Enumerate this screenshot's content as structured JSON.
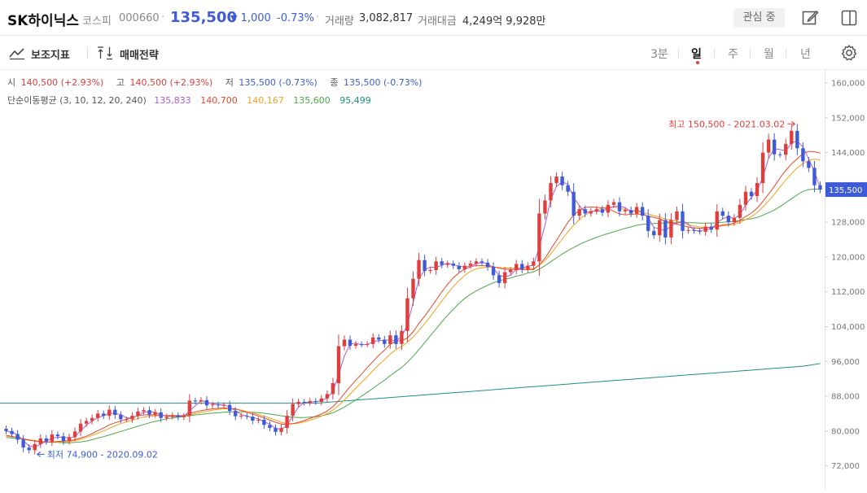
{
  "header": {
    "name": "SK하이닉스",
    "market": "코스피",
    "code": "000660",
    "price": "135,500",
    "change_arrow": "▼",
    "change": "1,000",
    "change_pct": "-0.73%",
    "volume_label": "거래량",
    "volume": "3,082,817",
    "amount_label": "거래대금",
    "amount": "4,249억 9,928만",
    "favorite_label": "관심 중"
  },
  "toolbar": {
    "indicator_label": "보조지표",
    "strategy_label": "매매전략",
    "periods": [
      "3분",
      "일",
      "주",
      "월",
      "년"
    ],
    "active_period": "일"
  },
  "legend": {
    "open_label": "시",
    "open": "140,500 (+2.93%)",
    "high_label": "고",
    "high": "140,500 (+2.93%)",
    "low_label": "저",
    "low": "135,500 (-0.73%)",
    "close_label": "종",
    "close": "135,500 (-0.73%)",
    "ma_label": "단순이동평균 (3, 10, 12, 20, 240)",
    "ma_values": [
      "135,833",
      "140,700",
      "140,167",
      "135,600",
      "95,499"
    ]
  },
  "colors": {
    "up": "#e03d3d",
    "down": "#3e5bd8",
    "ma3": "#b05bd6",
    "ma10": "#e8482a",
    "ma12": "#f2a11e",
    "ma20": "#4aa84a",
    "ma240": "#1f8f86"
  },
  "chart_data": {
    "type": "candlestick",
    "ylim": [
      66500,
      163000
    ],
    "y_ticks": [
      160000,
      152000,
      144000,
      136000,
      128000,
      120000,
      112000,
      104000,
      96000,
      88000,
      80000,
      72000
    ],
    "y_tick_labels": [
      "160,000",
      "152,000",
      "144,000",
      "135,500",
      "128,000",
      "120,000",
      "112,000",
      "104,000",
      "96,000",
      "88,000",
      "80,000",
      "72,000"
    ],
    "current_price": 135500,
    "current_price_label": "135,500",
    "max_annotation": "최고 150,500 - 2021.03.02",
    "min_annotation": "최저 74,900 - 2020.09.02",
    "close": [
      80000,
      79300,
      78000,
      76200,
      75600,
      77000,
      78300,
      77600,
      79200,
      78800,
      77700,
      78600,
      79900,
      81700,
      82300,
      83000,
      84000,
      83500,
      84900,
      83700,
      82700,
      82700,
      83500,
      84500,
      84800,
      83800,
      84300,
      83000,
      83300,
      83600,
      83200,
      83500,
      87000,
      86800,
      87100,
      85900,
      86100,
      85900,
      86000,
      84600,
      83400,
      83500,
      83300,
      82400,
      82600,
      81400,
      80700,
      79800,
      80700,
      83500,
      86200,
      86700,
      86500,
      86900,
      86700,
      87500,
      88500,
      91000,
      99500,
      101000,
      99600,
      100000,
      99900,
      100000,
      101500,
      101000,
      100000,
      102000,
      100000,
      103000,
      110500,
      115000,
      119300,
      116800,
      117000,
      119000,
      118200,
      118500,
      118000,
      117200,
      118000,
      118500,
      119000,
      118700,
      117700,
      115800,
      114000,
      116500,
      117000,
      118400,
      117200,
      118000,
      119000,
      130000,
      133000,
      137000,
      138500,
      136500,
      135000,
      129500,
      131000,
      130000,
      130500,
      131000,
      130200,
      132000,
      132600,
      130500,
      130800,
      130000,
      131500,
      129500,
      126000,
      125000,
      128500,
      124500,
      128500,
      130500,
      126000,
      126200,
      126000,
      125800,
      127000,
      126300,
      130500,
      129500,
      128000,
      129000,
      132000,
      135000,
      134000,
      137000,
      144000,
      147000,
      143600,
      143500,
      146000,
      149000,
      145000,
      142000,
      140500,
      136500,
      135500
    ],
    "ma3": [
      80000,
      79700,
      79100,
      77800,
      76600,
      76300,
      77000,
      77600,
      78400,
      78500,
      78600,
      78400,
      78700,
      80100,
      81300,
      82300,
      83100,
      83500,
      84100,
      84000,
      83800,
      83000,
      83000,
      83600,
      84300,
      84400,
      84300,
      83700,
      83500,
      83300,
      83400,
      83400,
      84600,
      85800,
      87000,
      86600,
      86300,
      86000,
      86000,
      85500,
      84700,
      83800,
      83400,
      83100,
      82800,
      82100,
      81600,
      80600,
      80400,
      81300,
      83500,
      85500,
      86500,
      86700,
      86700,
      87000,
      87600,
      89000,
      93000,
      97200,
      100000,
      100200,
      99800,
      99900,
      100500,
      100800,
      100800,
      101000,
      100700,
      101700,
      104500,
      109500,
      115000,
      117000,
      117700,
      117600,
      118100,
      118600,
      118200,
      117900,
      117700,
      117900,
      118500,
      118700,
      118500,
      117400,
      115800,
      115400,
      115800,
      117300,
      117500,
      117900,
      118100,
      122300,
      127300,
      133300,
      136200,
      137300,
      136700,
      133700,
      131800,
      130200,
      130500,
      130500,
      130600,
      131100,
      131600,
      131700,
      131300,
      130400,
      130800,
      130300,
      129000,
      126800,
      126500,
      126000,
      127200,
      127800,
      128300,
      127600,
      126100,
      126000,
      126300,
      126400,
      127900,
      128800,
      129300,
      128800,
      129700,
      132000,
      133700,
      135300,
      138300,
      142700,
      144900,
      144700,
      144400,
      146200,
      146700,
      145300,
      142500,
      139700,
      135800
    ],
    "ma10": [
      79000,
      78800,
      78500,
      78200,
      77900,
      77700,
      77500,
      77400,
      77500,
      77600,
      77700,
      77800,
      78000,
      78400,
      78800,
      79400,
      80100,
      80700,
      81400,
      81900,
      82300,
      82700,
      83100,
      83500,
      83700,
      83700,
      83700,
      83600,
      83500,
      83500,
      83500,
      83600,
      84000,
      84400,
      84700,
      84900,
      85100,
      85200,
      85300,
      85200,
      85100,
      84700,
      84300,
      83900,
      83500,
      83000,
      82500,
      82000,
      81600,
      81500,
      81700,
      82000,
      82400,
      82900,
      83400,
      83900,
      84600,
      85600,
      87000,
      88600,
      90200,
      91700,
      93100,
      94600,
      96000,
      97400,
      98600,
      99900,
      100700,
      100800,
      101400,
      102800,
      104700,
      106400,
      108200,
      110100,
      112000,
      113700,
      115200,
      116400,
      117300,
      117700,
      118100,
      118000,
      118000,
      117800,
      117400,
      117200,
      117100,
      117200,
      117100,
      117100,
      117100,
      118200,
      119700,
      121800,
      123800,
      125900,
      128000,
      129600,
      130800,
      131400,
      131500,
      131400,
      131300,
      131100,
      130500,
      129900,
      129700,
      129800,
      129900,
      129800,
      129400,
      129100,
      128800,
      128200,
      127900,
      127600,
      127200,
      126900,
      126700,
      126600,
      126700,
      126800,
      127000,
      127400,
      127500,
      127800,
      128400,
      129300,
      130100,
      131200,
      132800,
      134500,
      136200,
      138200,
      139900,
      141400,
      142600,
      143800,
      144300,
      144200,
      143900
    ],
    "ma12": [
      78800,
      78700,
      78500,
      78200,
      78000,
      77800,
      77600,
      77500,
      77500,
      77500,
      77500,
      77600,
      77800,
      78100,
      78500,
      79000,
      79500,
      80000,
      80600,
      81200,
      81700,
      82100,
      82500,
      82900,
      83200,
      83400,
      83500,
      83600,
      83600,
      83600,
      83600,
      83500,
      83700,
      84000,
      84300,
      84500,
      84800,
      85000,
      85100,
      85100,
      85000,
      84800,
      84500,
      84200,
      83800,
      83400,
      83000,
      82500,
      82000,
      81700,
      81700,
      81800,
      82100,
      82500,
      82900,
      83400,
      84000,
      84800,
      85900,
      87100,
      88500,
      89900,
      91200,
      92500,
      93900,
      95200,
      96400,
      97700,
      98700,
      99400,
      100400,
      101600,
      103100,
      104700,
      106300,
      108100,
      109900,
      111600,
      113200,
      114600,
      115800,
      116700,
      117300,
      117500,
      117700,
      117700,
      117600,
      117500,
      117400,
      117400,
      117400,
      117400,
      117300,
      118100,
      119200,
      120700,
      122400,
      124100,
      125800,
      127300,
      128600,
      129700,
      130300,
      130800,
      131200,
      131500,
      131500,
      131200,
      130900,
      130600,
      130500,
      130300,
      129900,
      129500,
      129200,
      128700,
      128500,
      128200,
      127800,
      127400,
      127100,
      126900,
      126800,
      126800,
      126900,
      127200,
      127300,
      127500,
      127900,
      128600,
      129300,
      130200,
      131500,
      132900,
      134400,
      136100,
      137700,
      139200,
      140500,
      141500,
      142200,
      142500,
      142300
    ],
    "ma20": [
      78500,
      78400,
      78300,
      78100,
      77900,
      77800,
      77600,
      77500,
      77400,
      77400,
      77300,
      77300,
      77400,
      77500,
      77700,
      78000,
      78400,
      78700,
      79100,
      79500,
      79900,
      80300,
      80700,
      81100,
      81500,
      81900,
      82200,
      82500,
      82800,
      83000,
      83200,
      83300,
      83500,
      83700,
      83800,
      84000,
      84100,
      84200,
      84300,
      84400,
      84400,
      84400,
      84400,
      84300,
      84200,
      84100,
      83900,
      83700,
      83500,
      83300,
      83200,
      83100,
      83100,
      83200,
      83300,
      83500,
      83800,
      84200,
      84800,
      85500,
      86300,
      87100,
      88000,
      88900,
      89800,
      90800,
      91700,
      92700,
      93700,
      94600,
      95800,
      97200,
      98700,
      100300,
      101900,
      103500,
      105100,
      106600,
      108000,
      109300,
      110500,
      111400,
      112200,
      112900,
      113500,
      114100,
      114500,
      114900,
      115200,
      115600,
      115900,
      116300,
      116600,
      117200,
      118000,
      118900,
      119800,
      120700,
      121500,
      122200,
      122900,
      123500,
      124000,
      124500,
      125000,
      125400,
      125800,
      126200,
      126600,
      126900,
      127300,
      127500,
      127600,
      127700,
      127800,
      127800,
      127900,
      127900,
      127900,
      127900,
      127900,
      127800,
      127800,
      127800,
      127900,
      128000,
      128100,
      128200,
      128400,
      128600,
      128800,
      129100,
      129600,
      130200,
      130800,
      131600,
      132500,
      133400,
      134300,
      135100,
      135500,
      135600,
      135600
    ],
    "ma240": [
      86400,
      86400,
      86400,
      86400,
      86400,
      86400,
      86400,
      86400,
      86400,
      86400,
      86400,
      86400,
      86400,
      86400,
      86400,
      86400,
      86400,
      86400,
      86400,
      86400,
      86400,
      86400,
      86400,
      86400,
      86400,
      86400,
      86400,
      86400,
      86400,
      86400,
      86400,
      86400,
      86400,
      86400,
      86400,
      86400,
      86400,
      86400,
      86400,
      86400,
      86400,
      86400,
      86400,
      86400,
      86400,
      86400,
      86400,
      86400,
      86400,
      86400,
      86400,
      86400,
      86400,
      86400,
      86400,
      86500,
      86600,
      86700,
      86800,
      86900,
      87000,
      87100,
      87200,
      87300,
      87400,
      87500,
      87600,
      87700,
      87800,
      87900,
      88000,
      88100,
      88200,
      88300,
      88400,
      88500,
      88600,
      88700,
      88800,
      88900,
      89000,
      89100,
      89200,
      89300,
      89400,
      89500,
      89600,
      89700,
      89800,
      89900,
      90000,
      90100,
      90200,
      90300,
      90400,
      90500,
      90600,
      90700,
      90800,
      90900,
      91000,
      91100,
      91200,
      91300,
      91400,
      91500,
      91600,
      91700,
      91800,
      91900,
      92000,
      92100,
      92200,
      92300,
      92400,
      92500,
      92600,
      92700,
      92800,
      92900,
      93000,
      93100,
      93200,
      93300,
      93400,
      93500,
      93600,
      93700,
      93800,
      93900,
      94000,
      94100,
      94200,
      94300,
      94400,
      94500,
      94600,
      94700,
      94800,
      94900,
      95100,
      95300,
      95499
    ]
  }
}
